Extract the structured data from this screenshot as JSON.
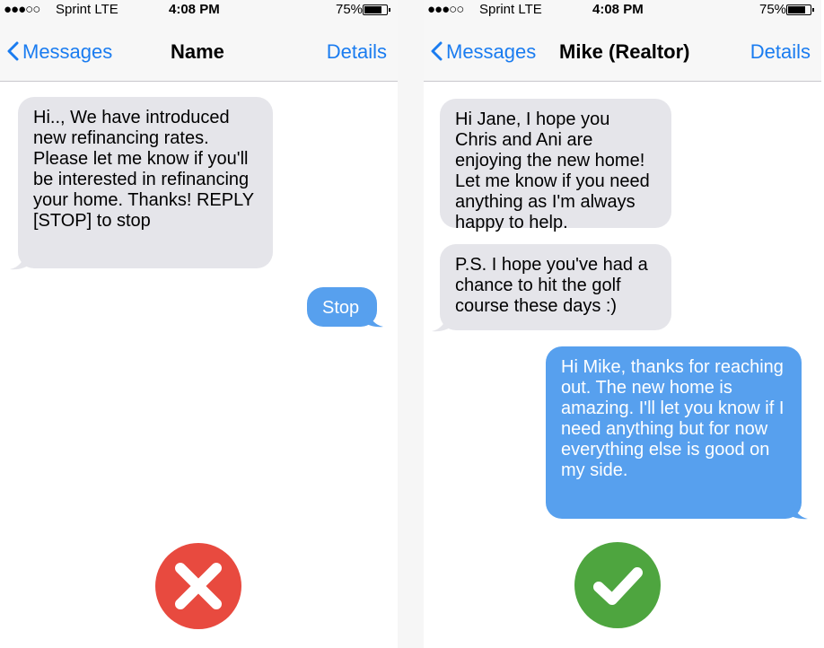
{
  "left_phone": {
    "status": {
      "signal": "●●●○○",
      "carrier": "Sprint  LTE",
      "time": "4:08 PM",
      "battery": "75%"
    },
    "nav": {
      "back": "Messages",
      "title": "Name",
      "details": "Details"
    },
    "messages": [
      {
        "from": "them",
        "text": "Hi.., We have introduced new refinancing rates. Please let me know if you'll be interested in refinancing your home. Thanks! REPLY [STOP] to stop"
      },
      {
        "from": "me",
        "text": "Stop"
      }
    ],
    "verdict": {
      "icon": "x-mark-icon",
      "color": "#e84a3f"
    }
  },
  "right_phone": {
    "status": {
      "signal": "●●●○○",
      "carrier": "Sprint  LTE",
      "time": "4:08 PM",
      "battery": "75%"
    },
    "nav": {
      "back": "Messages",
      "title": "Mike (Realtor)",
      "details": "Details"
    },
    "messages": [
      {
        "from": "them",
        "text": "Hi Jane, I hope you Chris and Ani are enjoying the new home! Let me know if you need anything as I'm always happy to help."
      },
      {
        "from": "them",
        "text": "P.S. I hope you've had a chance to hit the golf course these days :)"
      },
      {
        "from": "me",
        "text": "Hi Mike, thanks for reaching out. The new home is amazing. I'll let you know if I need anything but for now everything else is good on my side."
      }
    ],
    "verdict": {
      "icon": "check-mark-icon",
      "color": "#4ea53f"
    }
  },
  "colors": {
    "ios_blue": "#1a7cf0",
    "bubble_gray": "#e5e5ea",
    "bubble_blue": "#57a0ee"
  }
}
